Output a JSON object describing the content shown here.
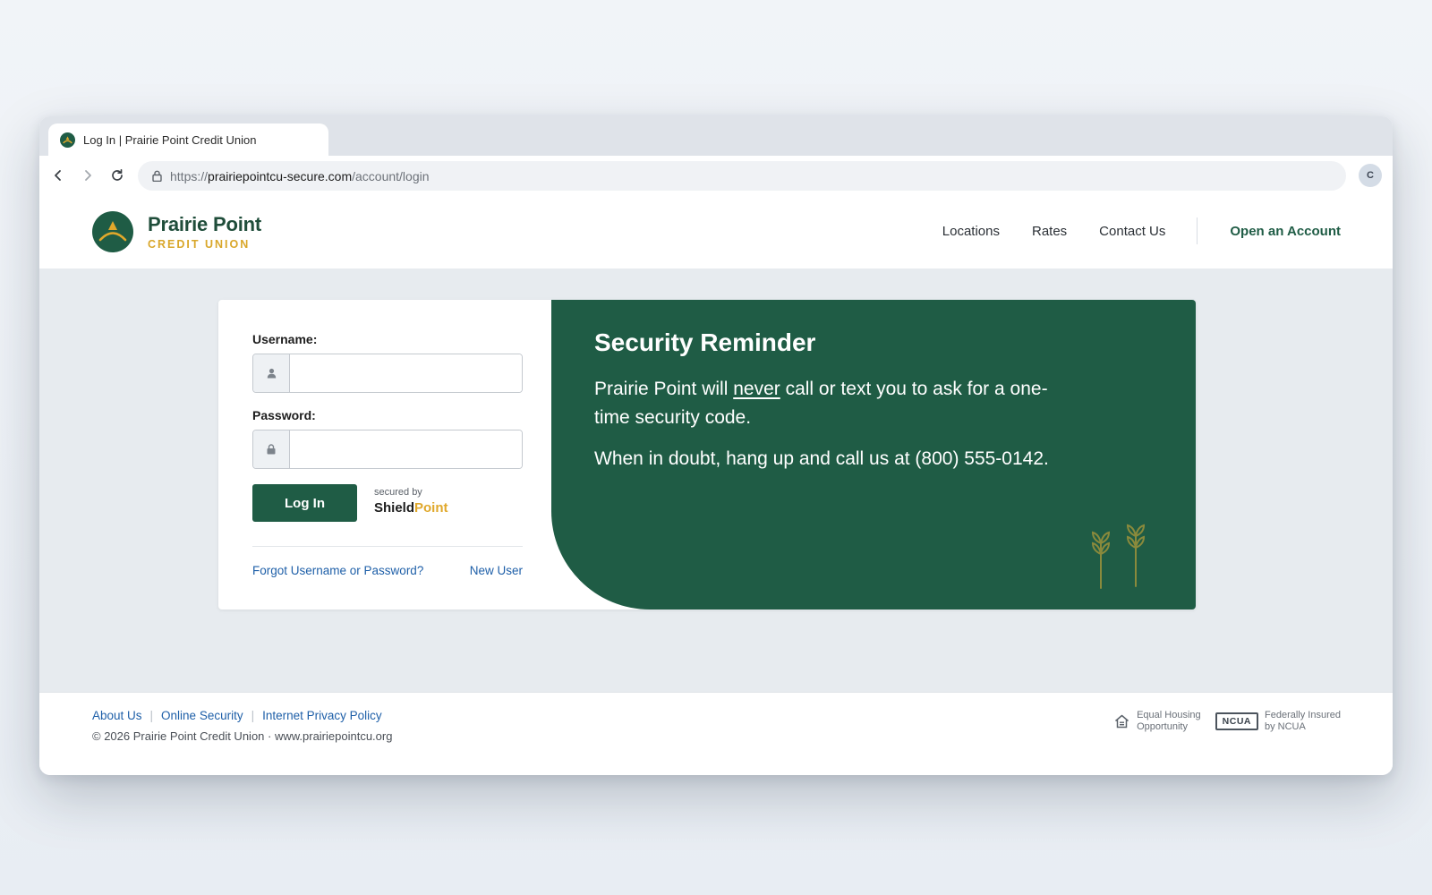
{
  "browser": {
    "tab_title": "Log In | Prairie Point Credit Union",
    "url_scheme": "https://",
    "url_host": "prairiepointcu-secure.com",
    "url_path": "/account/login",
    "profile_initial": "C"
  },
  "header": {
    "brand_name": "Prairie Point",
    "brand_sub": "CREDIT UNION",
    "nav": [
      "Locations",
      "Rates",
      "Contact Us"
    ],
    "cta": "Open an Account"
  },
  "login": {
    "username_label": "Username:",
    "password_label": "Password:",
    "login_button": "Log In",
    "secured_by": "secured by",
    "secured_brand_a": "Shield",
    "secured_brand_b": "Point",
    "forgot_link": "Forgot Username or Password?",
    "new_user_link": "New User"
  },
  "reminder": {
    "title": "Security Reminder",
    "p1_before": "Prairie Point will ",
    "p1_emphasis": "never",
    "p1_after": " call or text you to ask for a one-time security code.",
    "p2": "When in doubt, hang up and call us at (800) 555-0142."
  },
  "footer": {
    "links": [
      "About Us",
      "Online Security",
      "Internet Privacy Policy"
    ],
    "copyright": "© 2026 Prairie Point Credit Union · www.prairiepointcu.org",
    "ehl_line1": "Equal Housing",
    "ehl_line2": "Opportunity",
    "ncua_badge": "NCUA",
    "ncua_line1": "Federally Insured",
    "ncua_line2": "by NCUA"
  },
  "colors": {
    "brand_green": "#1f5c45",
    "brand_gold": "#d9a72a",
    "link_blue": "#1e5fa8"
  }
}
